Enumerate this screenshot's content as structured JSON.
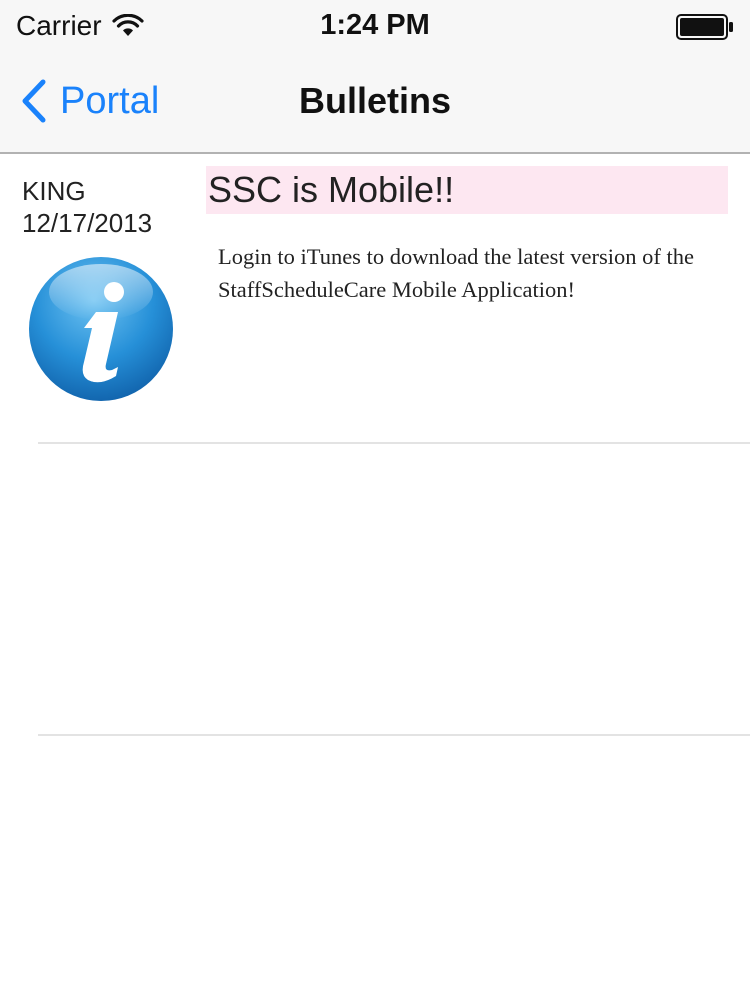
{
  "status_bar": {
    "carrier": "Carrier",
    "time": "1:24 PM",
    "icons": [
      "wifi-icon",
      "battery-icon"
    ]
  },
  "nav_bar": {
    "back_label": "Portal",
    "title": "Bulletins",
    "accent_color": "#1a82fb"
  },
  "bulletins": [
    {
      "author": "KING",
      "date": "12/17/2013",
      "icon": "info-icon",
      "title": "SSC is Mobile!!",
      "body": "Login to iTunes to download the latest version of the StaffScheduleCare Mobile Application!",
      "title_highlight_color": "#fde7f1"
    }
  ]
}
